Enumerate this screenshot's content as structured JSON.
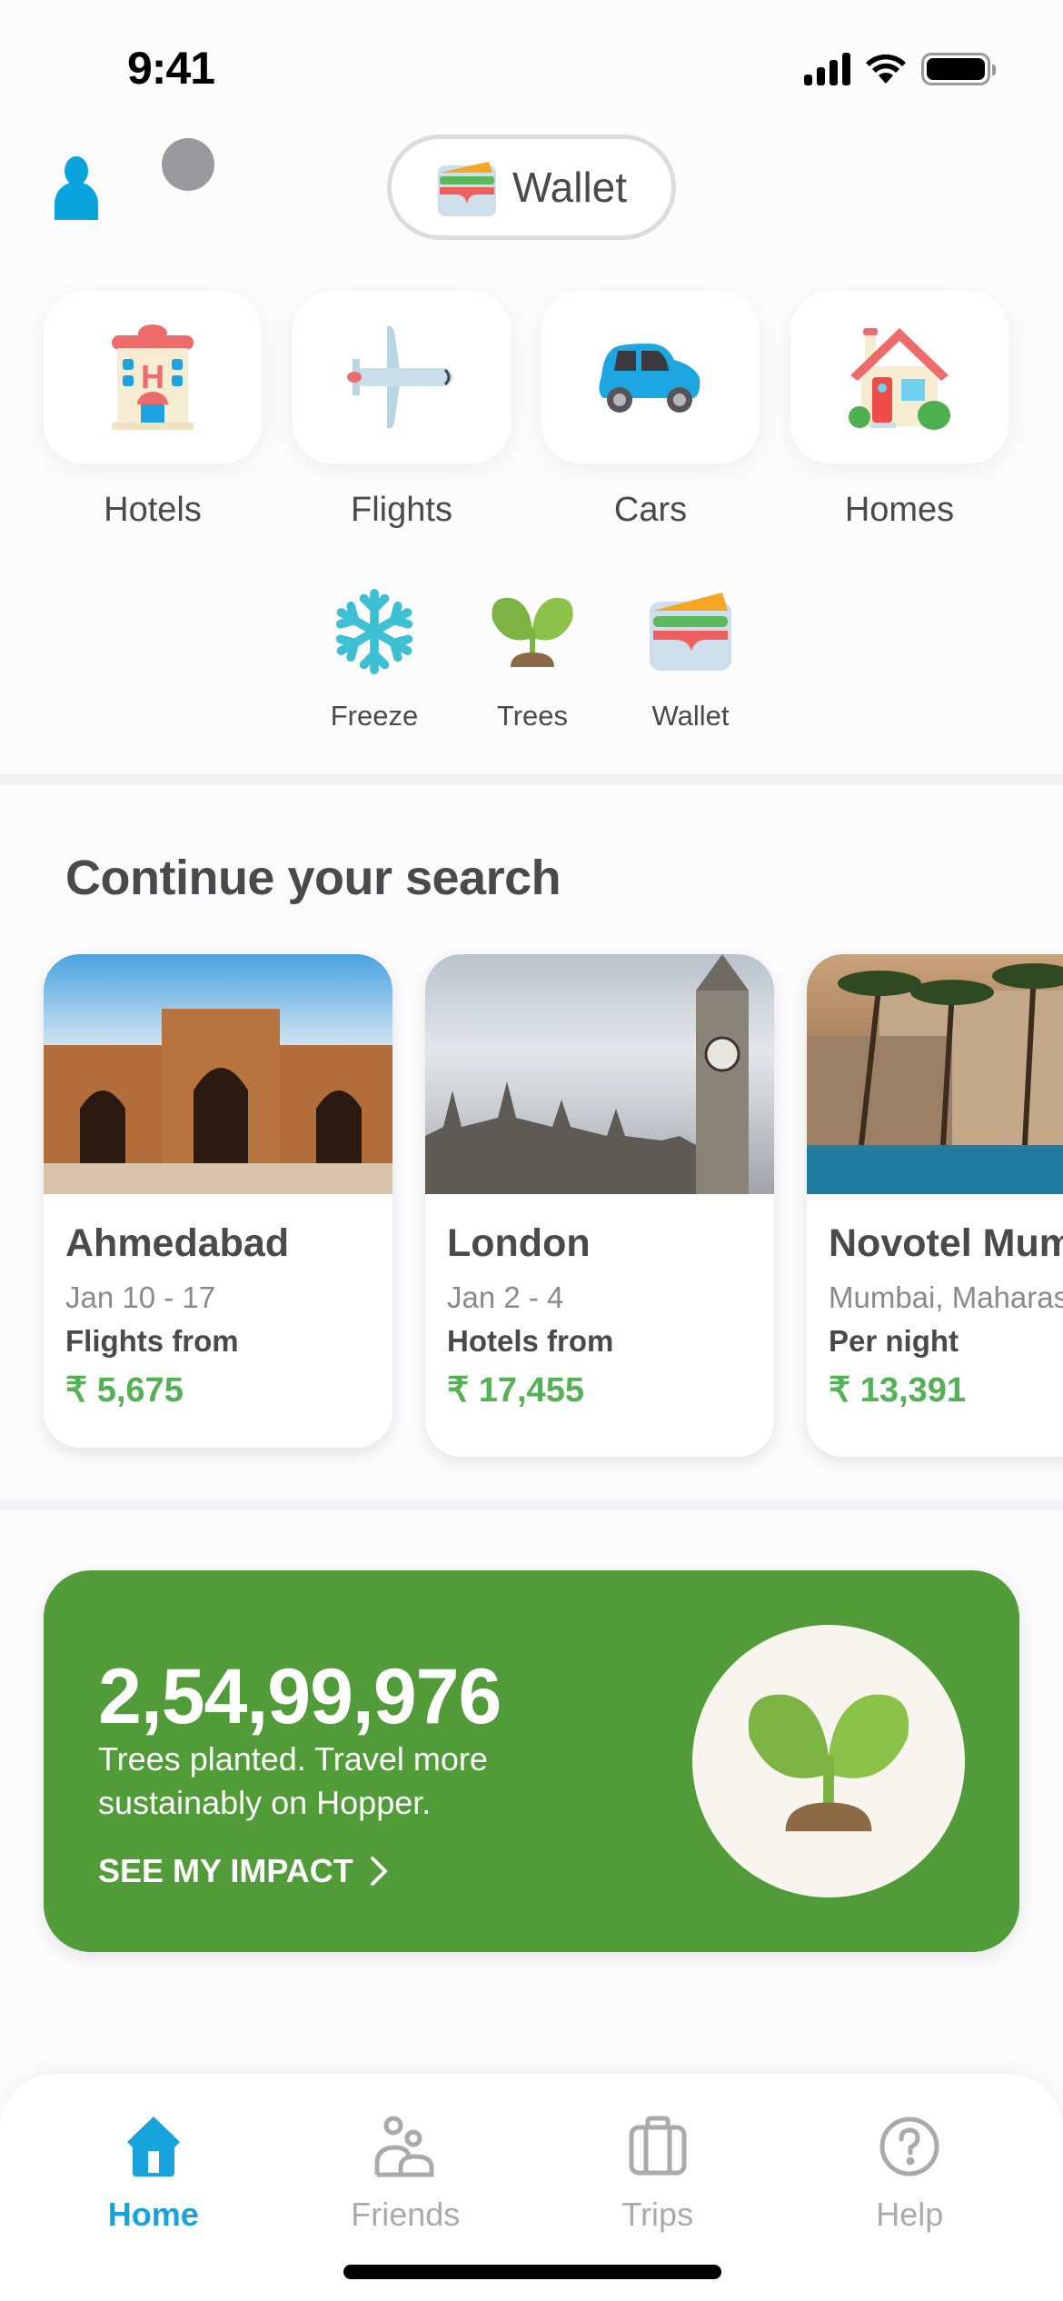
{
  "status_bar": {
    "time": "9:41"
  },
  "header": {
    "wallet_label": "Wallet"
  },
  "categories": [
    {
      "label": "Hotels",
      "icon": "hotel-icon"
    },
    {
      "label": "Flights",
      "icon": "airplane-icon"
    },
    {
      "label": "Cars",
      "icon": "car-icon"
    },
    {
      "label": "Homes",
      "icon": "house-icon"
    }
  ],
  "shortcuts": [
    {
      "label": "Freeze",
      "icon": "snowflake-icon"
    },
    {
      "label": "Trees",
      "icon": "seedling-icon"
    },
    {
      "label": "Wallet",
      "icon": "wallet-icon"
    }
  ],
  "continue_search": {
    "title": "Continue your search",
    "cards": [
      {
        "title": "Ahmedabad",
        "subtitle": "Jan 10 -  17",
        "kind": "Flights from",
        "price": "₹ 5,675",
        "image": "Ahmedabad mosque photo"
      },
      {
        "title": "London",
        "subtitle": "Jan 2 -  4",
        "kind": "Hotels from",
        "price": "₹ 17,455",
        "image": "Big Ben photo"
      },
      {
        "title": "Novotel Mumbai",
        "subtitle": "Mumbai, Maharashtra",
        "kind": "Per night",
        "price": "₹ 13,391",
        "image": "Hotel pool photo"
      }
    ]
  },
  "impact": {
    "count": "2,54,99,976",
    "text": "Trees planted. Travel more sustainably on Hopper.",
    "link": "SEE MY IMPACT"
  },
  "tab_bar": {
    "tabs": [
      {
        "label": "Home",
        "active": true
      },
      {
        "label": "Friends",
        "active": false
      },
      {
        "label": "Trips",
        "active": false
      },
      {
        "label": "Help",
        "active": false
      }
    ]
  },
  "colors": {
    "accent": "#17a3db",
    "price_green": "#55b155",
    "impact_green": "#519c39"
  }
}
